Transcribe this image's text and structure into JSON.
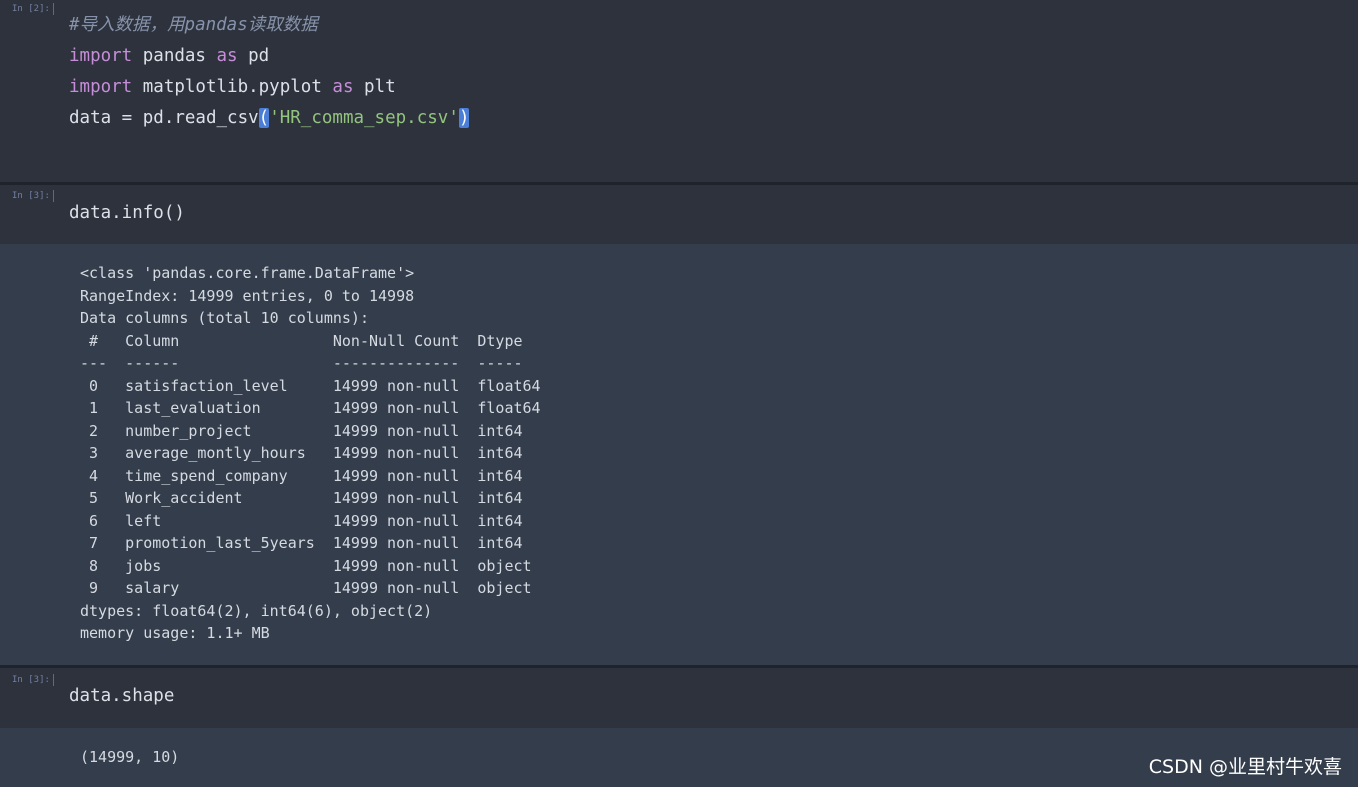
{
  "cells": [
    {
      "prompt": "In [2]:",
      "code": {
        "line1": "#导入数据，用pandas读取数据",
        "line2_kw1": "import",
        "line2_rest": " pandas ",
        "line2_kw2": "as",
        "line2_end": " pd",
        "line3_kw1": "import",
        "line3_rest": " matplotlib.pyplot ",
        "line3_kw2": "as",
        "line3_end": " plt",
        "line4_pre": "data = pd.read_csv",
        "line4_open": "(",
        "line4_str": "'HR_comma_sep.csv'",
        "line4_close": ")"
      }
    },
    {
      "prompt": "In [3]:",
      "code": "data.info()",
      "output": [
        "<class 'pandas.core.frame.DataFrame'>",
        "RangeIndex: 14999 entries, 0 to 14998",
        "Data columns (total 10 columns):",
        " #   Column                 Non-Null Count  Dtype  ",
        "---  ------                 --------------  -----  ",
        " 0   satisfaction_level     14999 non-null  float64",
        " 1   last_evaluation        14999 non-null  float64",
        " 2   number_project         14999 non-null  int64  ",
        " 3   average_montly_hours   14999 non-null  int64  ",
        " 4   time_spend_company     14999 non-null  int64  ",
        " 5   Work_accident          14999 non-null  int64  ",
        " 6   left                   14999 non-null  int64  ",
        " 7   promotion_last_5years  14999 non-null  int64  ",
        " 8   jobs                   14999 non-null  object ",
        " 9   salary                 14999 non-null  object ",
        "dtypes: float64(2), int64(6), object(2)",
        "memory usage: 1.1+ MB"
      ]
    },
    {
      "prompt": "In [3]:",
      "code": "data.shape",
      "output": [
        "(14999, 10)"
      ]
    }
  ],
  "watermark": "CSDN @业里村牛欢喜",
  "colors": {
    "cell_input_bg": "#2d323d",
    "output_bg": "#343d4b",
    "keyword": "#c68dd9",
    "string": "#93c47d",
    "comment": "#8793aa",
    "bracket_highlight": "#4b7ed6"
  }
}
